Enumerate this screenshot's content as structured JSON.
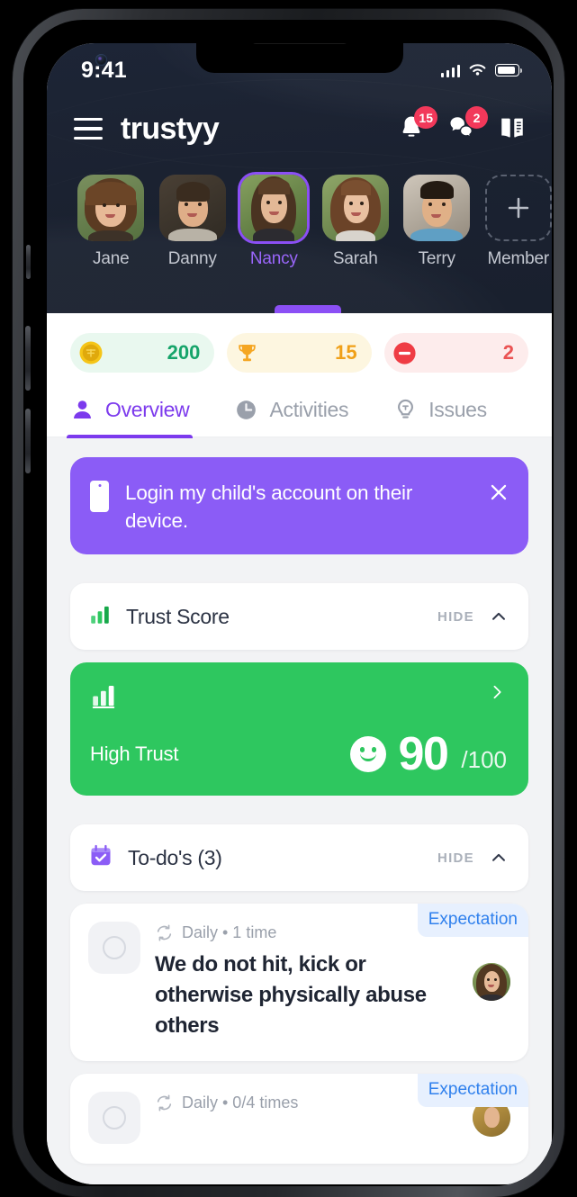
{
  "status_bar": {
    "time": "9:41",
    "signal_icon": "cellular-signal-icon",
    "wifi_icon": "wifi-icon",
    "battery_icon": "battery-icon"
  },
  "app_bar": {
    "menu_icon": "hamburger-menu-icon",
    "brand": "trustyy",
    "notifications": {
      "icon": "bell-icon",
      "badge": "15"
    },
    "messages": {
      "icon": "chat-bubbles-icon",
      "badge": "2"
    },
    "guide": {
      "icon": "book-icon"
    }
  },
  "members": [
    {
      "name": "Jane",
      "selected": false
    },
    {
      "name": "Danny",
      "selected": false
    },
    {
      "name": "Nancy",
      "selected": true
    },
    {
      "name": "Sarah",
      "selected": false
    },
    {
      "name": "Terry",
      "selected": false
    }
  ],
  "add_member": {
    "label": "Member",
    "icon": "plus-icon"
  },
  "stats": [
    {
      "key": "coins",
      "icon": "coin-icon",
      "value": "200"
    },
    {
      "key": "trophy",
      "icon": "trophy-icon",
      "value": "15"
    },
    {
      "key": "minus",
      "icon": "minus-circle-icon",
      "value": "2"
    }
  ],
  "tabs": [
    {
      "label": "Overview",
      "icon": "person-icon",
      "active": true
    },
    {
      "label": "Activities",
      "icon": "clock-icon",
      "active": false
    },
    {
      "label": "Issues",
      "icon": "lightbulb-icon",
      "active": false
    }
  ],
  "banner": {
    "icon": "mobile-phone-icon",
    "text": "Login my child's account on their device.",
    "close_icon": "close-x-icon"
  },
  "trust_section": {
    "icon": "bar-chart-icon",
    "title": "Trust Score",
    "hide_label": "HIDE",
    "chevron_icon": "chevron-up-icon"
  },
  "trust_card": {
    "icon": "bar-chart-icon",
    "arrow_icon": "chevron-right-icon",
    "label": "High Trust",
    "face_icon": "smiley-face-icon",
    "score": "90",
    "denominator": "/100"
  },
  "todos_section": {
    "icon": "calendar-check-icon",
    "title": "To-do's (3)",
    "hide_label": "HIDE",
    "chevron_icon": "chevron-up-icon"
  },
  "todos": [
    {
      "repeat_icon": "repeat-icon",
      "meta": "Daily • 1 time",
      "title": "We do not hit, kick or otherwise physically abuse others",
      "tag": "Expectation",
      "avatar": "member-avatar"
    },
    {
      "repeat_icon": "repeat-icon",
      "meta": "Daily • 0/4 times",
      "title": "",
      "tag": "Expectation",
      "avatar": "member-avatar"
    }
  ],
  "colors": {
    "header_dark": "#1b2231",
    "accent_purple": "#7c3aed",
    "banner_purple": "#8b5cf6",
    "trust_green": "#2ec75f",
    "badge_red": "#f2385a",
    "coin_green": "#16a46a",
    "trophy_orange": "#f0a018",
    "minus_red": "#ea5353",
    "tag_blue": "#2f80ed"
  }
}
